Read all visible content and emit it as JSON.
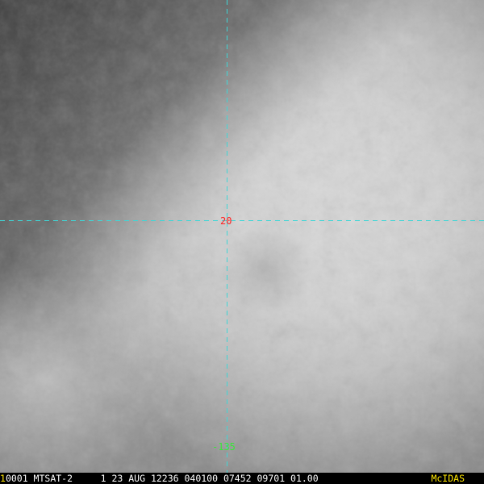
{
  "image": {
    "description_icon": "satellite-cloud-image",
    "colors": {
      "background_dark": "#4a4a4a",
      "cloud_bright": "#d2d2d2",
      "grid_line": "#3fd6d6",
      "lat_label": "#ff2020",
      "lon_label": "#39e639",
      "footer_number": "#ffe600",
      "footer_brand": "#ffe600",
      "footer_text": "#ffffff"
    }
  },
  "grid": {
    "latitude_label": "20",
    "longitude_label": "-135"
  },
  "footer": {
    "frame_number": "1",
    "info": "0001 MTSAT-2     1 23 AUG 12236 040100 07452 09701 01.00",
    "brand": "McIDAS"
  }
}
